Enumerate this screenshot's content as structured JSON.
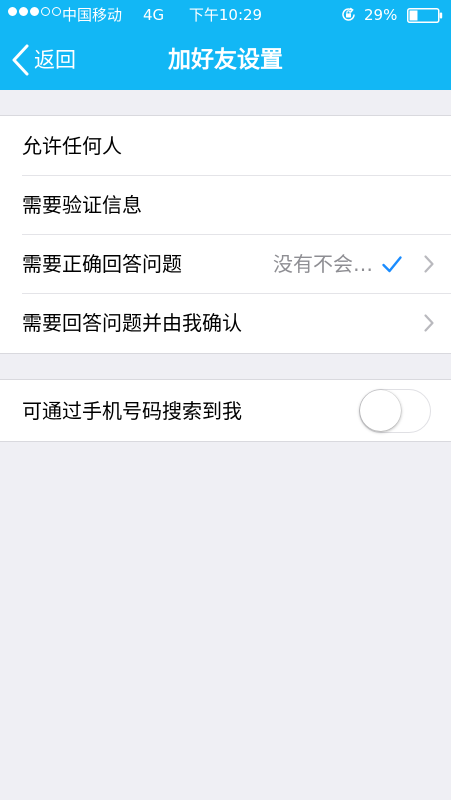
{
  "status_bar": {
    "carrier": "中国移动",
    "network": "4G",
    "time": "下午10:29",
    "battery_percent": "29%",
    "battery_level": 0.29,
    "signal_strength": 3,
    "signal_max": 5,
    "icons": [
      "signal-dots-icon",
      "rotation-lock-icon",
      "battery-icon"
    ]
  },
  "nav": {
    "back_label": "返回",
    "title": "加好友设置",
    "icons": [
      "back-chevron-icon"
    ]
  },
  "settings": {
    "options": [
      {
        "label": "允许任何人"
      },
      {
        "label": "需要验证信息"
      },
      {
        "label": "需要正确回答问题",
        "value": "没有不会…",
        "checked": true,
        "has_chevron": true
      },
      {
        "label": "需要回答问题并由我确认",
        "has_chevron": true
      }
    ],
    "phone_search": {
      "label": "可通过手机号码搜索到我",
      "enabled": false
    }
  },
  "colors": {
    "nav_background": "#12b7f5",
    "page_background": "#efeff4",
    "check_color": "#1a8cff",
    "secondary_text": "#8e8e93"
  }
}
